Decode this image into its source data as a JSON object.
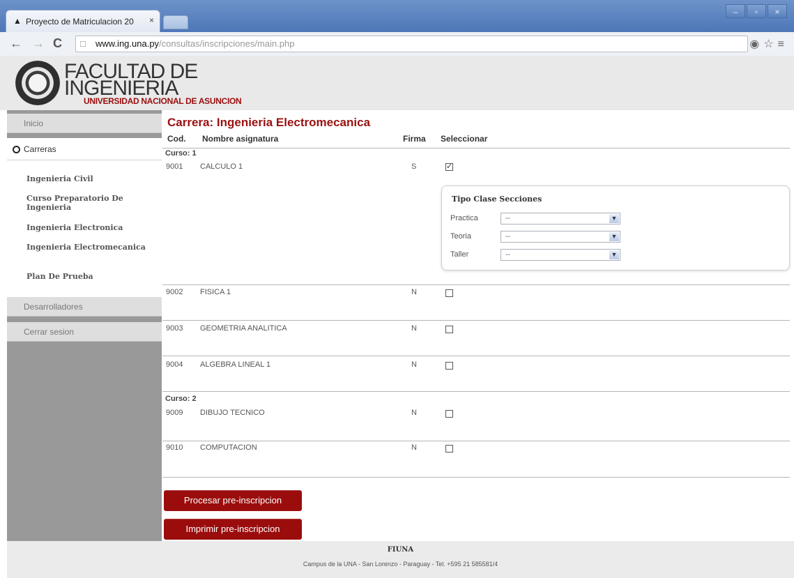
{
  "browser": {
    "tab_title": "Proyecto de Matriculacion 20",
    "tab_close": "×",
    "window_controls": [
      "–",
      "▫",
      "×"
    ],
    "back": "←",
    "forward": "→",
    "reload": "C",
    "url_host": "www.ing.una.py",
    "url_path": "/consultas/inscripciones/main.php",
    "address_icons": "◉☆≡"
  },
  "header": {
    "logo_line1": "FACULTAD DE",
    "logo_line2": "INGENIERIA",
    "logo_sub": "UNIVERSIDAD NACIONAL DE ASUNCION"
  },
  "sidebar": {
    "inicio": "Inicio",
    "carreras": "Carreras",
    "careers": [
      "Ingenieria Civil",
      "Curso Preparatorio De Ingenieria",
      "Ingenieria Electronica",
      "Ingenieria Electromecanica",
      "Plan De Prueba"
    ],
    "desarrolladores": "Desarrolladores",
    "cerrar": "Cerrar sesion"
  },
  "main": {
    "title": "Carrera: Ingenieria Electromecanica",
    "columns": {
      "cod": "Cod.",
      "nombre": "Nombre asignatura",
      "firma": "Firma",
      "seleccionar": "Seleccionar"
    },
    "curso1": "Curso: 1",
    "curso2": "Curso: 2",
    "subjects": [
      {
        "cod": "9001",
        "nombre": "CALCULO 1",
        "firma": "S",
        "selected": true
      },
      {
        "cod": "9002",
        "nombre": "FISICA 1",
        "firma": "N",
        "selected": false
      },
      {
        "cod": "9003",
        "nombre": "GEOMETRIA ANALITICA",
        "firma": "N",
        "selected": false
      },
      {
        "cod": "9004",
        "nombre": "ALGEBRA LINEAL 1",
        "firma": "N",
        "selected": false
      },
      {
        "cod": "9009",
        "nombre": "DIBUJO TECNICO",
        "firma": "N",
        "selected": false
      },
      {
        "cod": "9010",
        "nombre": "COMPUTACION",
        "firma": "N",
        "selected": false
      }
    ],
    "sections": {
      "title": "Tipo Clase Secciones",
      "practica": "Practica",
      "teoria": "Teoria",
      "taller": "Taller",
      "select_value": "--"
    },
    "buttons": {
      "procesar": "Procesar pre-inscripcion",
      "imprimir": "Imprimir pre-inscripcion"
    }
  },
  "footer": {
    "name": "FIUNA",
    "address": "Campus de la UNA - San Lorenzo - Paraguay - Tel. +595 21 585581/4"
  }
}
